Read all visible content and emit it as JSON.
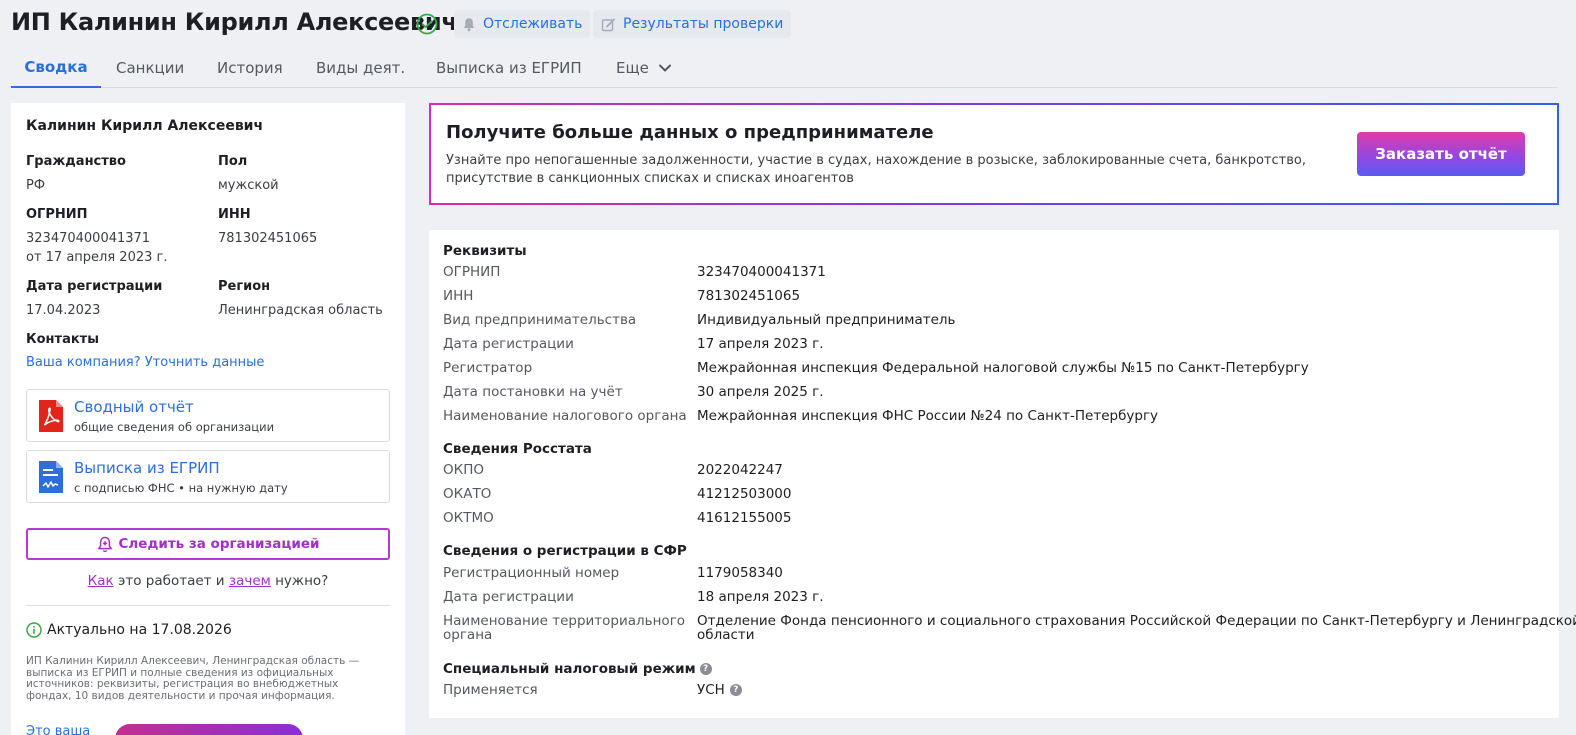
{
  "header": {
    "title": "ИП Калинин Кирилл Алексеевич",
    "track_label": "Отслеживать",
    "results_label": "Результаты проверки"
  },
  "tabs": [
    {
      "label": "Сводка",
      "active": true
    },
    {
      "label": "Санкции"
    },
    {
      "label": "История"
    },
    {
      "label": "Виды деят."
    },
    {
      "label": "Выписка из ЕГРИП"
    },
    {
      "label": "Еще"
    }
  ],
  "left": {
    "name": "Калинин Кирилл Алексеевич",
    "citizenship_label": "Гражданство",
    "citizenship": "РФ",
    "gender_label": "Пол",
    "gender": "мужской",
    "ogrnip_label": "ОГРНИП",
    "ogrnip": "323470400041371",
    "ogrnip_date": "от 17 апреля 2023 г.",
    "inn_label": "ИНН",
    "inn": "781302451065",
    "reg_date_label": "Дата регистрации",
    "reg_date": "17.04.2023",
    "region_label": "Регион",
    "region": "Ленинградская область",
    "contacts_label": "Контакты",
    "contacts_link": "Ваша компания? Уточнить данные",
    "doc1_title": "Сводный отчёт",
    "doc1_sub": "общие сведения об организации",
    "doc2_title": "Выписка из ЕГРИП",
    "doc2_sub": "с подписью ФНС • на нужную дату",
    "follow_label": "Следить за организацией",
    "how_link": "Как",
    "how_mid": " это работает и ",
    "why_link": "зачем",
    "how_end": " нужно?",
    "actual": "Актуально на 17.08.2026",
    "description": "ИП Калинин Кирилл Алексеевич, Ленинградская область — выписка из ЕГРИП и полные сведения из официальных источников: реквизиты, регистрация во внебюджетных фондах, 10 видов деятельности и прочая информация.",
    "bottom_link": "Это ваша"
  },
  "promo": {
    "title": "Получите больше данных о предпринимателе",
    "text": "Узнайте про непогашенные задолженности, участие в судах, нахождение в розыске, заблокированные счета, банкротство, присутствие в санкционных списках и списках иноагентов",
    "button": "Заказать отчёт"
  },
  "details": {
    "requisites_title": "Реквизиты",
    "requisites": [
      {
        "k": "ОГРНИП",
        "v": "323470400041371"
      },
      {
        "k": "ИНН",
        "v": "781302451065"
      },
      {
        "k": "Вид предпринимательства",
        "v": "Индивидуальный предприниматель"
      },
      {
        "k": "Дата регистрации",
        "v": "17 апреля 2023 г."
      },
      {
        "k": "Регистратор",
        "v": "Межрайонная инспекция Федеральной налоговой службы №15 по Санкт-Петербургу"
      },
      {
        "k": "Дата постановки на учёт",
        "v": "30 апреля 2025 г."
      },
      {
        "k": "Наименование налогового органа",
        "v": "Межрайонная инспекция ФНС России №24 по Санкт-Петербургу"
      }
    ],
    "rosstat_title": "Сведения Росстата",
    "rosstat": [
      {
        "k": "ОКПО",
        "v": "2022042247"
      },
      {
        "k": "ОКАТО",
        "v": "41212503000"
      },
      {
        "k": "ОКТМО",
        "v": "41612155005"
      }
    ],
    "sfr_title": "Сведения о регистрации в СФР",
    "sfr": [
      {
        "k": "Регистрационный номер",
        "v": "1179058340"
      },
      {
        "k": "Дата регистрации",
        "v": "18 апреля 2023 г."
      }
    ],
    "sfr_org_k1": "Наименование территориального",
    "sfr_org_k2": "органа",
    "sfr_org_v1": "Отделение Фонда пенсионного и социального страхования Российской Федерации по Санкт-Петербургу и Ленинградской",
    "sfr_org_v2": "области",
    "tax_title": "Специальный налоговый режим",
    "tax_k": "Применяется",
    "tax_v": "УСН",
    "q_mark": "?"
  },
  "colors": {
    "accent": "#2a6fdb",
    "purple": "#a22fc9",
    "green": "#3aa84a",
    "pdf_red": "#e1251b",
    "doc_blue": "#2a6fdb"
  }
}
